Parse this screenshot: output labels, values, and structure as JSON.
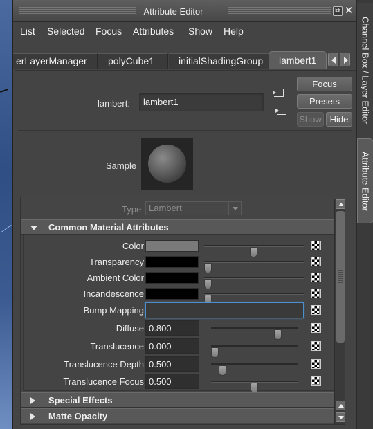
{
  "window": {
    "title": "Attribute Editor"
  },
  "menubar": [
    "List",
    "Selected",
    "Focus",
    "Attributes",
    "Show",
    "Help"
  ],
  "tabs": [
    {
      "label": "erLayerManager"
    },
    {
      "label": "polyCube1"
    },
    {
      "label": "initialShadingGroup"
    },
    {
      "label": "lambert1"
    }
  ],
  "node": {
    "type_label": "lambert:",
    "name": "lambert1"
  },
  "buttons": {
    "focus": "Focus",
    "presets": "Presets",
    "show": "Show",
    "hide": "Hide"
  },
  "sample": {
    "label": "Sample"
  },
  "type": {
    "label": "Type",
    "value": "Lambert"
  },
  "sections": {
    "common": "Common Material Attributes",
    "special": "Special Effects",
    "matte": "Matte Opacity"
  },
  "attributes": [
    {
      "label": "Color",
      "kind": "color",
      "color": "#7a7a7a",
      "slider": 0.5
    },
    {
      "label": "Transparency",
      "kind": "color",
      "color": "#000000",
      "slider": 0.0
    },
    {
      "label": "Ambient Color",
      "kind": "color",
      "color": "#000000",
      "slider": 0.0
    },
    {
      "label": "Incandescence",
      "kind": "color",
      "color": "#000000",
      "slider": 0.0
    },
    {
      "label": "Bump Mapping",
      "kind": "map",
      "value": ""
    },
    {
      "label": "Diffuse",
      "kind": "number",
      "value": "0.800",
      "slider": 0.8
    },
    {
      "label": "Translucence",
      "kind": "number",
      "value": "0.000",
      "slider": 0.0
    },
    {
      "label": "Translucence Depth",
      "kind": "number",
      "value": "0.500",
      "slider": 0.1
    },
    {
      "label": "Translucence Focus",
      "kind": "number",
      "value": "0.500",
      "slider": 0.5
    }
  ],
  "side_tabs": {
    "channel_box": "Channel Box / Layer Editor",
    "attribute_editor": "Attribute Editor"
  },
  "icons": {
    "input_connection": "input-connection-icon",
    "output_connection": "output-connection-icon",
    "map_button": "checker-map-icon"
  }
}
